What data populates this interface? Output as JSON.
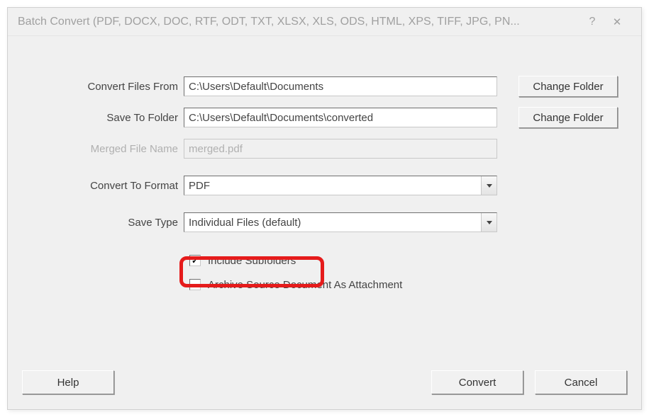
{
  "title": "Batch Convert (PDF, DOCX, DOC, RTF, ODT, TXT, XLSX, XLS, ODS, HTML, XPS, TIFF, JPG, PN...",
  "labels": {
    "convert_from": "Convert Files From",
    "save_to": "Save To Folder",
    "merged_name": "Merged File Name",
    "convert_format": "Convert To Format",
    "save_type": "Save Type"
  },
  "values": {
    "convert_from": "C:\\Users\\Default\\Documents",
    "save_to": "C:\\Users\\Default\\Documents\\converted",
    "merged_name": "merged.pdf",
    "convert_format": "PDF",
    "save_type": "Individual Files (default)"
  },
  "checkboxes": {
    "include_subfolders": {
      "label": "Include Subfolders",
      "checked": true
    },
    "archive_source": {
      "label": "Archive Source Document As Attachment",
      "checked": false
    }
  },
  "buttons": {
    "change_folder": "Change Folder",
    "help": "Help",
    "convert": "Convert",
    "cancel": "Cancel"
  }
}
